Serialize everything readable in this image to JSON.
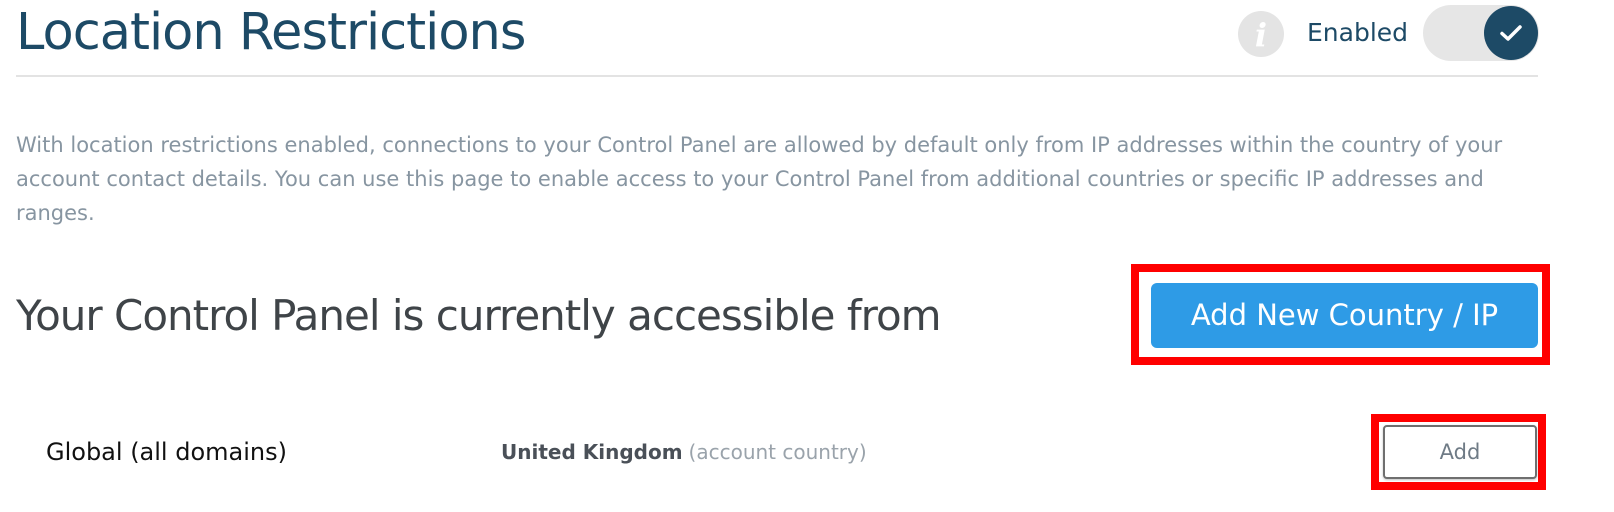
{
  "header": {
    "title": "Location Restrictions",
    "info_icon": "info-icon",
    "toggle_label": "Enabled",
    "toggle_state": "on",
    "toggle_icon": "checkmark-icon"
  },
  "description": "With location restrictions enabled, connections to your Control Panel are allowed by default only from IP addresses within the country of your account contact details. You can use this page to enable access to your Control Panel from additional countries or specific IP addresses and ranges.",
  "section": {
    "heading": "Your Control Panel is currently accessible from",
    "add_new_button": "Add New Country / IP"
  },
  "rows": [
    {
      "label": "Global (all domains)",
      "country": "United Kingdom",
      "note": "(account country)",
      "action": "Add"
    }
  ],
  "colors": {
    "title": "#1d4a66",
    "primary_button": "#2e9be6",
    "highlight": "#ff0000",
    "description_text": "#8795a1"
  }
}
